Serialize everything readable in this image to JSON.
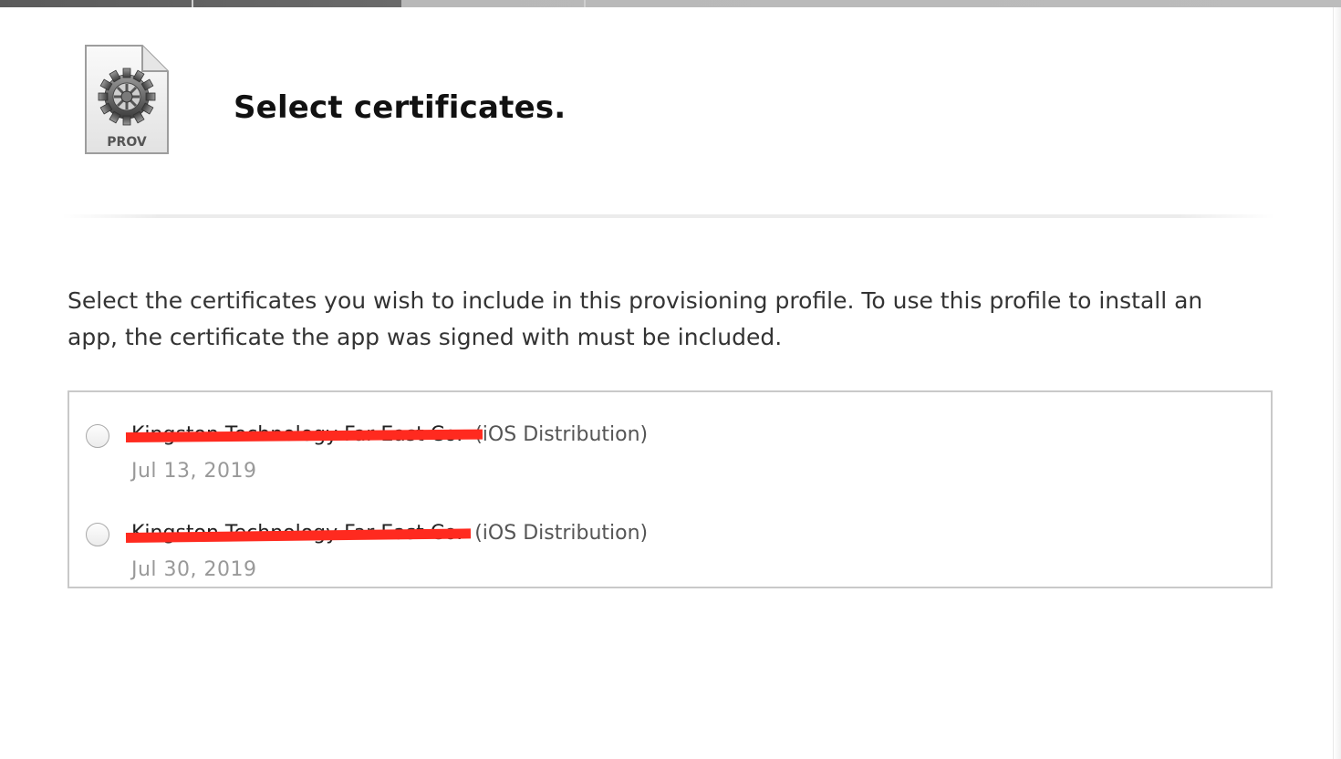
{
  "header": {
    "title": "Select certificates.",
    "icon_label": "PROV",
    "icon_name": "provisioning-profile-icon"
  },
  "description": "Select the certificates you wish to include in this provisioning profile. To use this profile to install an app, the certificate the app was signed with must be included.",
  "certificates": [
    {
      "name": "Kingston Technology Far East Co.",
      "type": "(iOS Distribution)",
      "date": "Jul 13, 2019",
      "selected": false
    },
    {
      "name": "Kingston Technology Far East Co.",
      "type": "(iOS Distribution)",
      "date": "Jul 30, 2019",
      "selected": false
    }
  ],
  "colors": {
    "redaction": "#ff2a1f",
    "border": "#c9c9c9",
    "date_text": "#999999"
  }
}
